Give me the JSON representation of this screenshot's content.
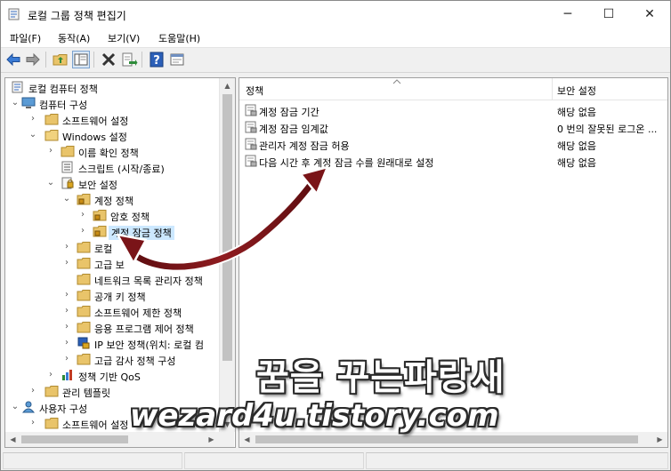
{
  "window": {
    "title": "로컬 그룹 정책 편집기",
    "minimize_glyph": "─",
    "maximize_glyph": "☐",
    "close_glyph": "✕"
  },
  "menu": [
    "파일(F)",
    "동작(A)",
    "보기(V)",
    "도움말(H)"
  ],
  "toolbar_icons": [
    "back-icon",
    "forward-icon",
    "up-folder-icon",
    "show-hide-tree-icon",
    "delete-icon",
    "export-list-icon",
    "help-icon",
    "properties-icon"
  ],
  "tree": {
    "items": [
      {
        "label": "로컬 컴퓨터 정책",
        "icon": "policy-doc-icon"
      },
      {
        "label": "컴퓨터 구성",
        "icon": "computer-icon"
      },
      {
        "label": "소프트웨어 설정",
        "icon": "folder-icon"
      },
      {
        "label": "Windows 설정",
        "icon": "folder-icon"
      },
      {
        "label": "이름 확인 정책",
        "icon": "folder-icon"
      },
      {
        "label": "스크립트 (시작/종료)",
        "icon": "script-icon"
      },
      {
        "label": "보안 설정",
        "icon": "security-icon"
      },
      {
        "label": "계정 정책",
        "icon": "lock-folder-icon"
      },
      {
        "label": "암호 정책",
        "icon": "lock-folder-icon"
      },
      {
        "label": "계정 잠금 정책",
        "icon": "lock-folder-icon"
      },
      {
        "label": "로컬",
        "icon": "folder-icon"
      },
      {
        "label": "고급 보",
        "icon": "folder-icon"
      },
      {
        "label": "네트워크 목록 관리자 정책",
        "icon": "folder-icon"
      },
      {
        "label": "공개 키 정책",
        "icon": "folder-icon"
      },
      {
        "label": "소프트웨어 제한 정책",
        "icon": "folder-icon"
      },
      {
        "label": "응용 프로그램 제어 정책",
        "icon": "folder-icon"
      },
      {
        "label": "IP 보안 정책(위치: 로컬 컴",
        "icon": "ip-security-icon"
      },
      {
        "label": "고급 감사 정책 구성",
        "icon": "folder-icon"
      },
      {
        "label": "정책 기반 QoS",
        "icon": "qos-chart-icon"
      },
      {
        "label": "관리 템플릿",
        "icon": "folder-icon"
      },
      {
        "label": "사용자 구성",
        "icon": "user-icon"
      },
      {
        "label": "소프트웨어 설정",
        "icon": "folder-icon"
      }
    ],
    "selected_index": 9
  },
  "details": {
    "column_policy": "정책",
    "column_setting": "보안 설정",
    "rows": [
      {
        "name": "계정 잠금 기간",
        "value": "해당 없음"
      },
      {
        "name": "계정 잠금 임계값",
        "value": "0 번의 잘못된 로그온 ..."
      },
      {
        "name": "관리자 계정 잠금 허용",
        "value": "해당 없음"
      },
      {
        "name": "다음 시간 후 계정 잠금 수를 원래대로 설정",
        "value": "해당 없음"
      }
    ]
  },
  "watermark": {
    "line1": "꿈을 꾸는파랑새",
    "line2": "wezard4u.tistory.com"
  },
  "colors": {
    "selection": "#cce8ff",
    "annotation_arrow": "#7a1418",
    "folder": "#e9c46a"
  }
}
